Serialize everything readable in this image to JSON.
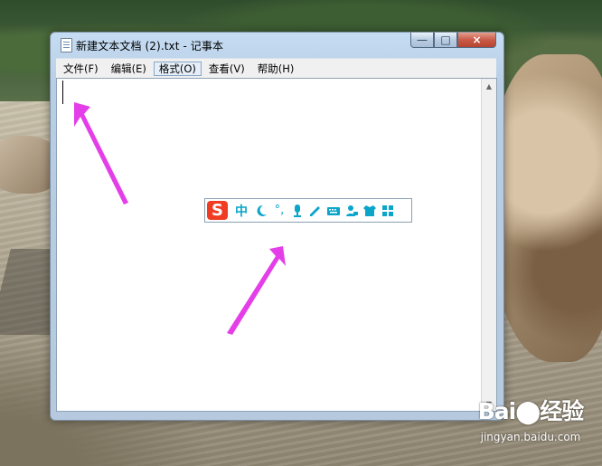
{
  "window": {
    "title": "新建文本文档 (2).txt - 记事本",
    "menu": [
      {
        "label": "文件(F)"
      },
      {
        "label": "编辑(E)"
      },
      {
        "label": "格式(O)"
      },
      {
        "label": "查看(V)"
      },
      {
        "label": "帮助(H)"
      }
    ]
  },
  "ime": {
    "logo": "S",
    "mode": "中",
    "buttons": [
      "moon-icon",
      "punctuation-icon",
      "microphone-icon",
      "pencil-icon",
      "keyboard-icon",
      "user-icon",
      "shirt-icon",
      "grid-icon"
    ]
  },
  "watermark": {
    "logo": "Bai⬤经验",
    "url": "jingyan.baidu.com"
  }
}
